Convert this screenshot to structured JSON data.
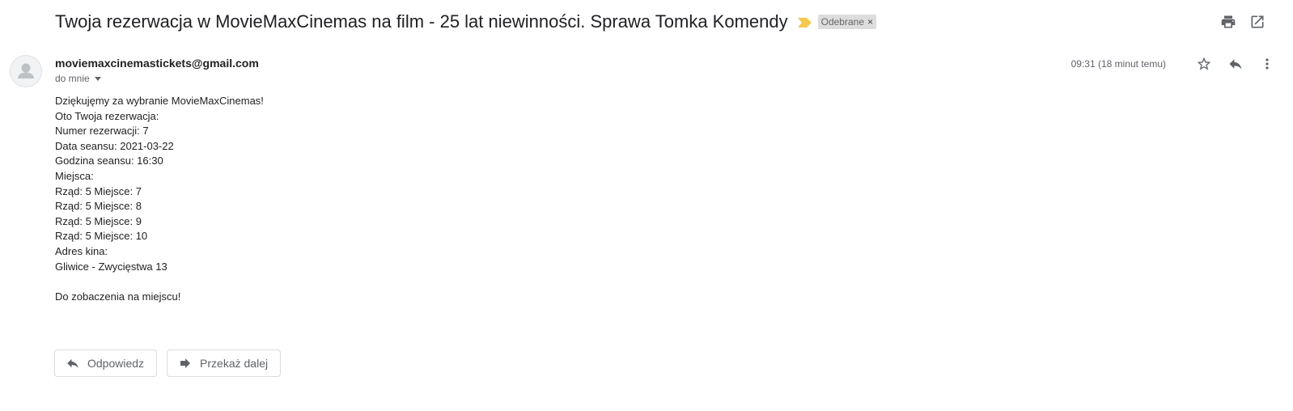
{
  "email": {
    "subject": "Twoja rezerwacja w MovieMaxCinemas na film - 25 lat niewinności. Sprawa Tomka Komendy",
    "label": "Odebrane",
    "label_remove": "×",
    "sender": "moviemaxcinemastickets@gmail.com",
    "recipient": "do mnie",
    "timestamp": "09:31 (18 minut temu)",
    "body_lines": [
      "Dziękujęmy za wybranie MovieMaxCinemas!",
      "Oto Twoja rezerwacja:",
      "Numer rezerwacji: 7",
      "Data seansu: 2021-03-22",
      "Godzina seansu: 16:30",
      "Miejsca:",
      "Rząd: 5 Miejsce: 7",
      "Rząd: 5 Miejsce: 8",
      "Rząd: 5 Miejsce: 9",
      "Rząd: 5 Miejsce: 10",
      "Adres kina:",
      "Gliwice - Zwycięstwa 13",
      "",
      "Do zobaczenia na miejscu!"
    ]
  },
  "actions": {
    "reply_label": "Odpowiedz",
    "forward_label": "Przekaż dalej"
  },
  "icons": {
    "importance": "importance-marker-icon",
    "print": "print-icon",
    "new_window": "open-in-new-window-icon",
    "avatar": "default-avatar-icon",
    "star": "star-icon",
    "reply": "reply-icon",
    "more": "more-vert-icon",
    "forward": "forward-icon"
  },
  "colors": {
    "importance": "#f2c94c",
    "label_bg": "#dddddd",
    "icon_gray": "#5f6368"
  }
}
